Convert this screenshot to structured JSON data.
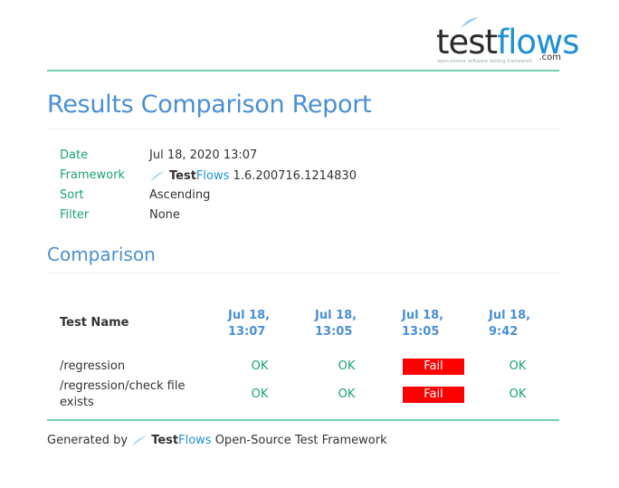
{
  "logo": {
    "word_test": "test",
    "word_flows": "flows",
    "com": ".com",
    "tagline": "open-source software testing framework"
  },
  "title": "Results Comparison Report",
  "meta": [
    {
      "key": "Date",
      "value": "Jul 18, 2020 13:07"
    },
    {
      "key": "Framework",
      "brand_test": "Test",
      "brand_flows": "Flows",
      "value": "1.6.200716.1214830"
    },
    {
      "key": "Sort",
      "value": "Ascending"
    },
    {
      "key": "Filter",
      "value": "None"
    }
  ],
  "comparison": {
    "heading": "Comparison",
    "name_header": "Test Name",
    "columns": [
      {
        "line1": "Jul 18,",
        "line2": "13:07"
      },
      {
        "line1": "Jul 18,",
        "line2": "13:05"
      },
      {
        "line1": "Jul 18,",
        "line2": "13:05"
      },
      {
        "line1": "Jul 18,",
        "line2": "9:42"
      }
    ],
    "rows": [
      {
        "name": "/regression",
        "results": [
          "OK",
          "OK",
          "Fail",
          "OK"
        ]
      },
      {
        "name": "/regression/check file exists",
        "results": [
          "OK",
          "OK",
          "Fail",
          "OK"
        ]
      }
    ]
  },
  "footer": {
    "prefix": "Generated by",
    "brand_test": "Test",
    "brand_flows": "Flows",
    "suffix": "Open-Source Test Framework"
  },
  "colors": {
    "accent_blue": "#4a8fd6",
    "accent_green": "#18a373",
    "rule_green": "#6fd1ad",
    "fail_red": "#ff0000"
  }
}
